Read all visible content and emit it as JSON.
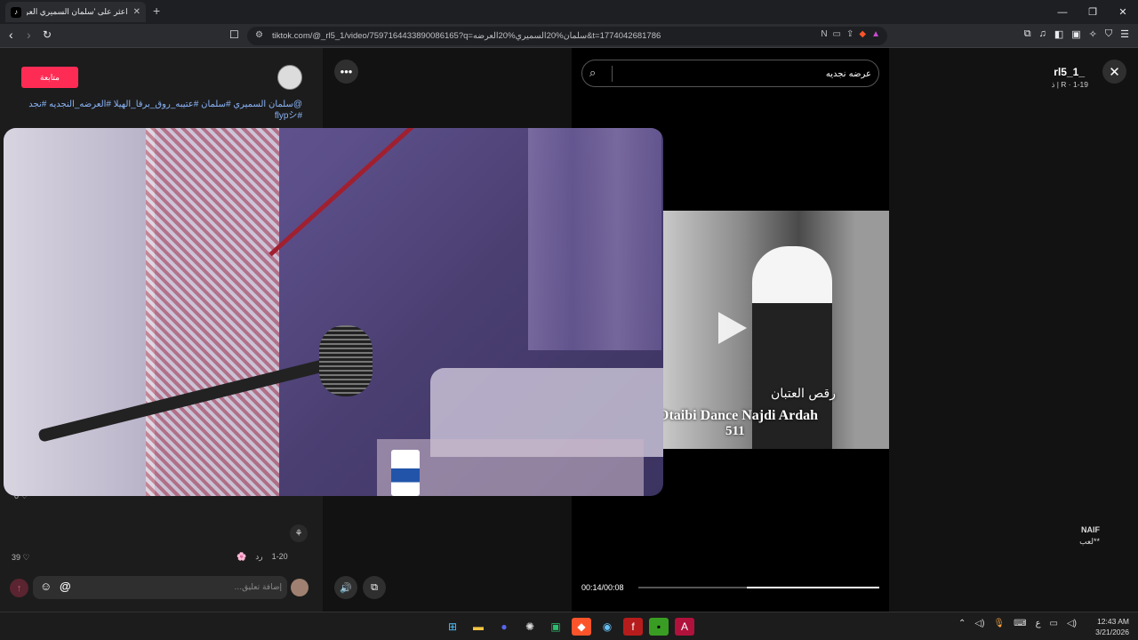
{
  "browser": {
    "tab_title": "اعثر على 'سلمان السميري العرضه",
    "tab_favicon": "tiktok-icon",
    "new_tab_label": "+",
    "url": "tiktok.com/@_rl5_1/video/7597164433890086165?q=سلمان%20السميري%20العرضه&t=1774042681786",
    "window_controls": [
      "—",
      "❐",
      "✕"
    ]
  },
  "post": {
    "follow_label": "متابعة",
    "username": "rl5_1_",
    "meta": "ذ | R · 1-19",
    "caption": "@سلمان السميري #سلمان #عتيبه_روق_برقا_الهيلا #العرضه_النجديه #نجد #flypシ",
    "more_label": "•••"
  },
  "comments": {
    "first_likes": "0",
    "second": {
      "name": "NAIF",
      "text": "لعب**",
      "date": "1-20",
      "reply_label": "رد",
      "likes": "39"
    }
  },
  "composer": {
    "placeholder": "إضافة تعليق...",
    "emoji_label": "☺",
    "at_label": "@"
  },
  "search": {
    "value": "عرضه نجديه"
  },
  "preview": {
    "arabic_title": "رقص العتبان",
    "english_title": "Otaibi Dance Najdi Ardah",
    "number": "511",
    "time": "00:14/00:08",
    "progress": 0.55
  },
  "taskbar": {
    "time": "12:43 AM",
    "date": "3/21/2026",
    "lang": "ع"
  },
  "colors": {
    "accent": "#fe2c55",
    "link": "#8ab4f8"
  }
}
